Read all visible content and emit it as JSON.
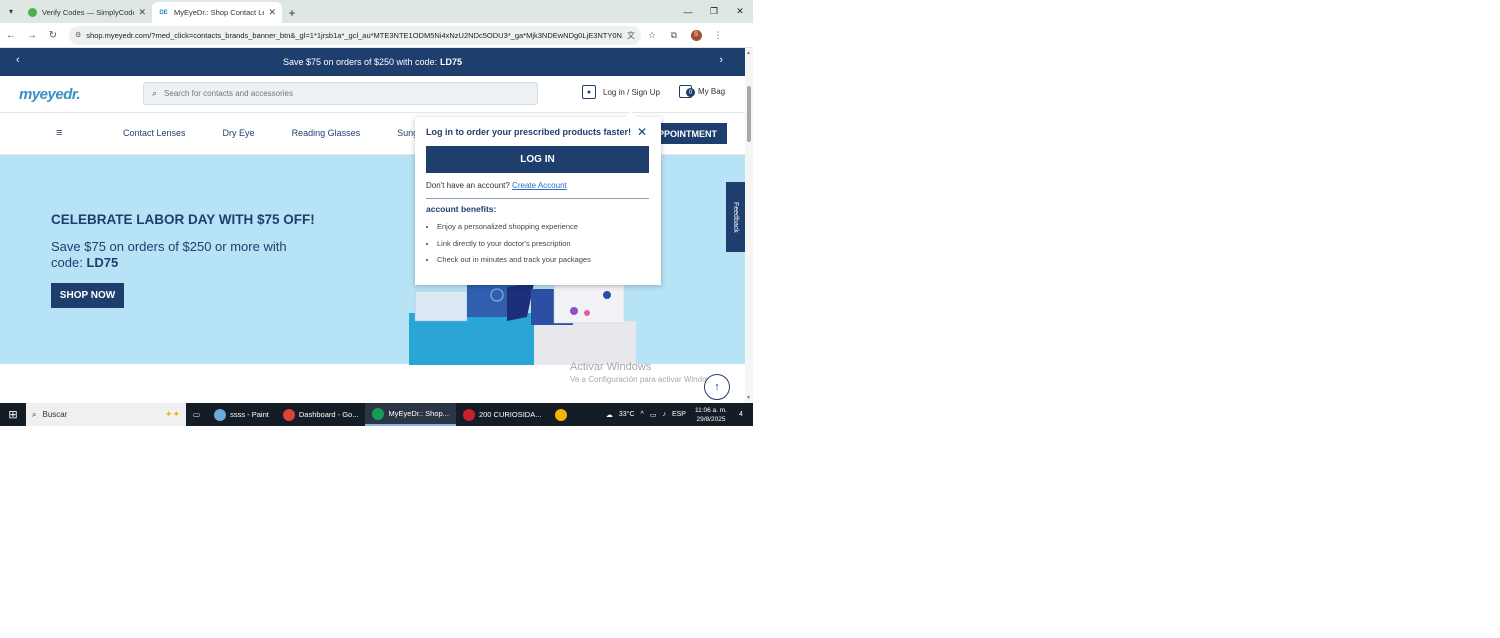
{
  "browser": {
    "tabs": [
      {
        "title": "Verify Codes — SimplyCodes",
        "active": false
      },
      {
        "title": "MyEyeDr.: Shop Contact Lenses",
        "active": true
      }
    ],
    "url": "shop.myeyedr.com/?med_click=contacts_brands_banner_btn&_gl=1*1jrsb1a*_gcl_au*MTE3NTE1ODM5Ni4xNzU2NDc5ODU3*_ga*Mjk3NDEwNDg0LjE3NTY0N...",
    "profile_initial": "S"
  },
  "promo_banner": {
    "text": "Save $75 on orders of $250 with code:",
    "code": "LD75"
  },
  "header": {
    "logo": "myeyedr.",
    "search_placeholder": "Search for contacts and accessories",
    "login_label": "Log in / Sign Up",
    "bag_label": "My Bag",
    "bag_count": "0"
  },
  "nav": {
    "links": [
      "Contact Lenses",
      "Dry Eye",
      "Reading Glasses",
      "Sung"
    ],
    "appointment_label": "PPOINTMENT"
  },
  "hero": {
    "headline": "CELEBRATE LABOR DAY WITH $75 OFF!",
    "subline": "Save $75 on orders of $250 or more with code:",
    "code": "LD75",
    "cta": "SHOP NOW"
  },
  "login_popover": {
    "title": "Log in to order your prescribed products faster!",
    "login_button": "LOG IN",
    "no_account": "Don't have an account?",
    "create_account": "Create Account",
    "benefits_heading": "account benefits:",
    "benefits": [
      "Enjoy a personalized shopping experience",
      "Link directly to your doctor's prescription",
      "Check out in minutes and track your packages"
    ]
  },
  "feedback_label": "Feedback",
  "watermark": {
    "line1": "Activar Windows",
    "line2": "Ve a Configuración para activar Windows."
  },
  "taskbar": {
    "search_label": "Buscar",
    "items": [
      {
        "label": "ssss - Paint",
        "active": false
      },
      {
        "label": "Dashboard - Go...",
        "active": false
      },
      {
        "label": "MyEyeDr.: Shop...",
        "active": true
      },
      {
        "label": "200 CURIOSIDA...",
        "active": false
      }
    ],
    "weather": "33°C",
    "language": "ESP",
    "time": "11:06 a. m.",
    "date": "29/8/2025",
    "notif_count": "4"
  },
  "colors": {
    "brand_navy": "#1e3f6e",
    "hero_bg": "#b7e3f6",
    "link_blue": "#2a6ec4"
  }
}
